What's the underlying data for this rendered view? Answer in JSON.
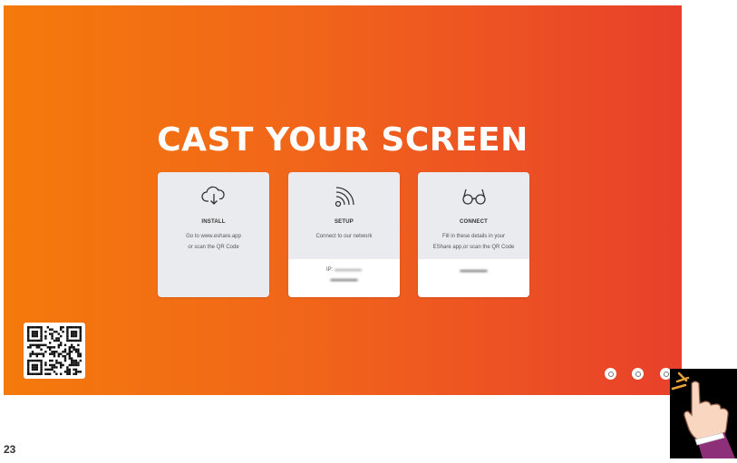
{
  "screen": {
    "title": "CAST YOUR SCREEN",
    "cards": [
      {
        "icon": "cloud-download-icon",
        "heading": "INSTALL",
        "lines": [
          "Go to www.eshare.app",
          "or scan the QR Code"
        ]
      },
      {
        "icon": "wifi-signal-icon",
        "heading": "SETUP",
        "lines": [
          "Connect to our network"
        ],
        "ip_label": "IP:"
      },
      {
        "icon": "glasses-icon",
        "heading": "CONNECT",
        "lines": [
          "Fill in these details in your",
          "EShare app,or scan the QR Code"
        ]
      }
    ],
    "bottom_icons": [
      "settings-small-icon",
      "settings-small-icon",
      "settings-icon"
    ]
  },
  "page_number": "23",
  "colors": {
    "gradient_start": "#f47a0b",
    "gradient_end": "#e8402b",
    "card_bg": "#e9ebee",
    "text_white": "#ffffff"
  }
}
